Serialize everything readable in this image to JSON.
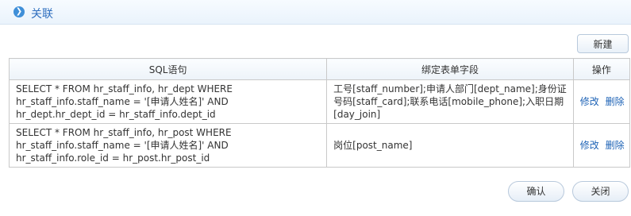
{
  "header": {
    "title": "关联"
  },
  "toolbar": {
    "new_label": "新建"
  },
  "table": {
    "columns": [
      "SQL语句",
      "绑定表单字段",
      "操作"
    ],
    "rows": [
      {
        "sql": "SELECT * FROM hr_staff_info, hr_dept WHERE hr_staff_info.staff_name = '[申请人姓名]' AND hr_dept.hr_dept_id = hr_staff_info.dept_id",
        "fields": "工号[staff_number];申请人部门[dept_name];身份证号码[staff_card];联系电话[mobile_phone];入职日期[day_join]",
        "edit": "修改",
        "delete": "删除"
      },
      {
        "sql": "SELECT * FROM hr_staff_info, hr_post WHERE hr_staff_info.staff_name = '[申请人姓名]' AND hr_staff_info.role_id = hr_post.hr_post_id",
        "fields": "岗位[post_name]",
        "edit": "修改",
        "delete": "删除"
      }
    ]
  },
  "footer": {
    "ok_label": "确认",
    "close_label": "关闭"
  }
}
